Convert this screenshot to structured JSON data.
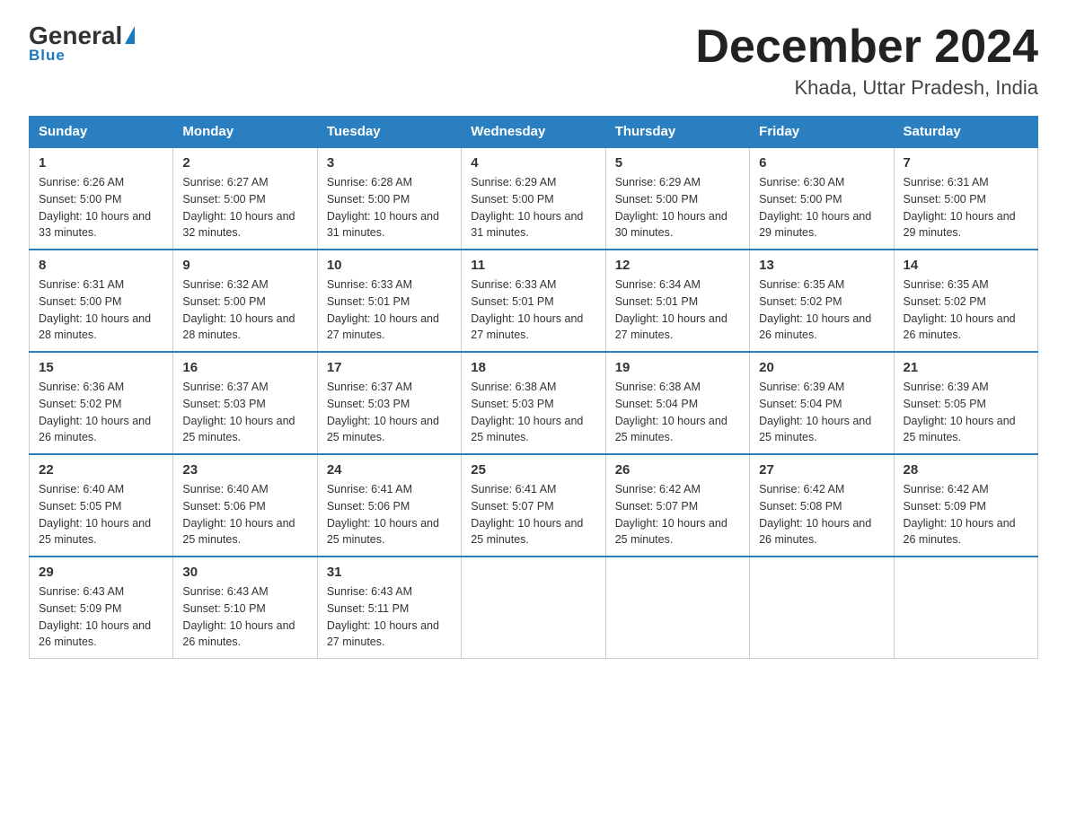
{
  "header": {
    "logo_main": "General",
    "logo_sub": "Blue",
    "title": "December 2024",
    "subtitle": "Khada, Uttar Pradesh, India"
  },
  "days_of_week": [
    "Sunday",
    "Monday",
    "Tuesday",
    "Wednesday",
    "Thursday",
    "Friday",
    "Saturday"
  ],
  "weeks": [
    [
      {
        "day": "1",
        "sunrise": "6:26 AM",
        "sunset": "5:00 PM",
        "daylight": "10 hours and 33 minutes."
      },
      {
        "day": "2",
        "sunrise": "6:27 AM",
        "sunset": "5:00 PM",
        "daylight": "10 hours and 32 minutes."
      },
      {
        "day": "3",
        "sunrise": "6:28 AM",
        "sunset": "5:00 PM",
        "daylight": "10 hours and 31 minutes."
      },
      {
        "day": "4",
        "sunrise": "6:29 AM",
        "sunset": "5:00 PM",
        "daylight": "10 hours and 31 minutes."
      },
      {
        "day": "5",
        "sunrise": "6:29 AM",
        "sunset": "5:00 PM",
        "daylight": "10 hours and 30 minutes."
      },
      {
        "day": "6",
        "sunrise": "6:30 AM",
        "sunset": "5:00 PM",
        "daylight": "10 hours and 29 minutes."
      },
      {
        "day": "7",
        "sunrise": "6:31 AM",
        "sunset": "5:00 PM",
        "daylight": "10 hours and 29 minutes."
      }
    ],
    [
      {
        "day": "8",
        "sunrise": "6:31 AM",
        "sunset": "5:00 PM",
        "daylight": "10 hours and 28 minutes."
      },
      {
        "day": "9",
        "sunrise": "6:32 AM",
        "sunset": "5:00 PM",
        "daylight": "10 hours and 28 minutes."
      },
      {
        "day": "10",
        "sunrise": "6:33 AM",
        "sunset": "5:01 PM",
        "daylight": "10 hours and 27 minutes."
      },
      {
        "day": "11",
        "sunrise": "6:33 AM",
        "sunset": "5:01 PM",
        "daylight": "10 hours and 27 minutes."
      },
      {
        "day": "12",
        "sunrise": "6:34 AM",
        "sunset": "5:01 PM",
        "daylight": "10 hours and 27 minutes."
      },
      {
        "day": "13",
        "sunrise": "6:35 AM",
        "sunset": "5:02 PM",
        "daylight": "10 hours and 26 minutes."
      },
      {
        "day": "14",
        "sunrise": "6:35 AM",
        "sunset": "5:02 PM",
        "daylight": "10 hours and 26 minutes."
      }
    ],
    [
      {
        "day": "15",
        "sunrise": "6:36 AM",
        "sunset": "5:02 PM",
        "daylight": "10 hours and 26 minutes."
      },
      {
        "day": "16",
        "sunrise": "6:37 AM",
        "sunset": "5:03 PM",
        "daylight": "10 hours and 25 minutes."
      },
      {
        "day": "17",
        "sunrise": "6:37 AM",
        "sunset": "5:03 PM",
        "daylight": "10 hours and 25 minutes."
      },
      {
        "day": "18",
        "sunrise": "6:38 AM",
        "sunset": "5:03 PM",
        "daylight": "10 hours and 25 minutes."
      },
      {
        "day": "19",
        "sunrise": "6:38 AM",
        "sunset": "5:04 PM",
        "daylight": "10 hours and 25 minutes."
      },
      {
        "day": "20",
        "sunrise": "6:39 AM",
        "sunset": "5:04 PM",
        "daylight": "10 hours and 25 minutes."
      },
      {
        "day": "21",
        "sunrise": "6:39 AM",
        "sunset": "5:05 PM",
        "daylight": "10 hours and 25 minutes."
      }
    ],
    [
      {
        "day": "22",
        "sunrise": "6:40 AM",
        "sunset": "5:05 PM",
        "daylight": "10 hours and 25 minutes."
      },
      {
        "day": "23",
        "sunrise": "6:40 AM",
        "sunset": "5:06 PM",
        "daylight": "10 hours and 25 minutes."
      },
      {
        "day": "24",
        "sunrise": "6:41 AM",
        "sunset": "5:06 PM",
        "daylight": "10 hours and 25 minutes."
      },
      {
        "day": "25",
        "sunrise": "6:41 AM",
        "sunset": "5:07 PM",
        "daylight": "10 hours and 25 minutes."
      },
      {
        "day": "26",
        "sunrise": "6:42 AM",
        "sunset": "5:07 PM",
        "daylight": "10 hours and 25 minutes."
      },
      {
        "day": "27",
        "sunrise": "6:42 AM",
        "sunset": "5:08 PM",
        "daylight": "10 hours and 26 minutes."
      },
      {
        "day": "28",
        "sunrise": "6:42 AM",
        "sunset": "5:09 PM",
        "daylight": "10 hours and 26 minutes."
      }
    ],
    [
      {
        "day": "29",
        "sunrise": "6:43 AM",
        "sunset": "5:09 PM",
        "daylight": "10 hours and 26 minutes."
      },
      {
        "day": "30",
        "sunrise": "6:43 AM",
        "sunset": "5:10 PM",
        "daylight": "10 hours and 26 minutes."
      },
      {
        "day": "31",
        "sunrise": "6:43 AM",
        "sunset": "5:11 PM",
        "daylight": "10 hours and 27 minutes."
      },
      null,
      null,
      null,
      null
    ]
  ]
}
